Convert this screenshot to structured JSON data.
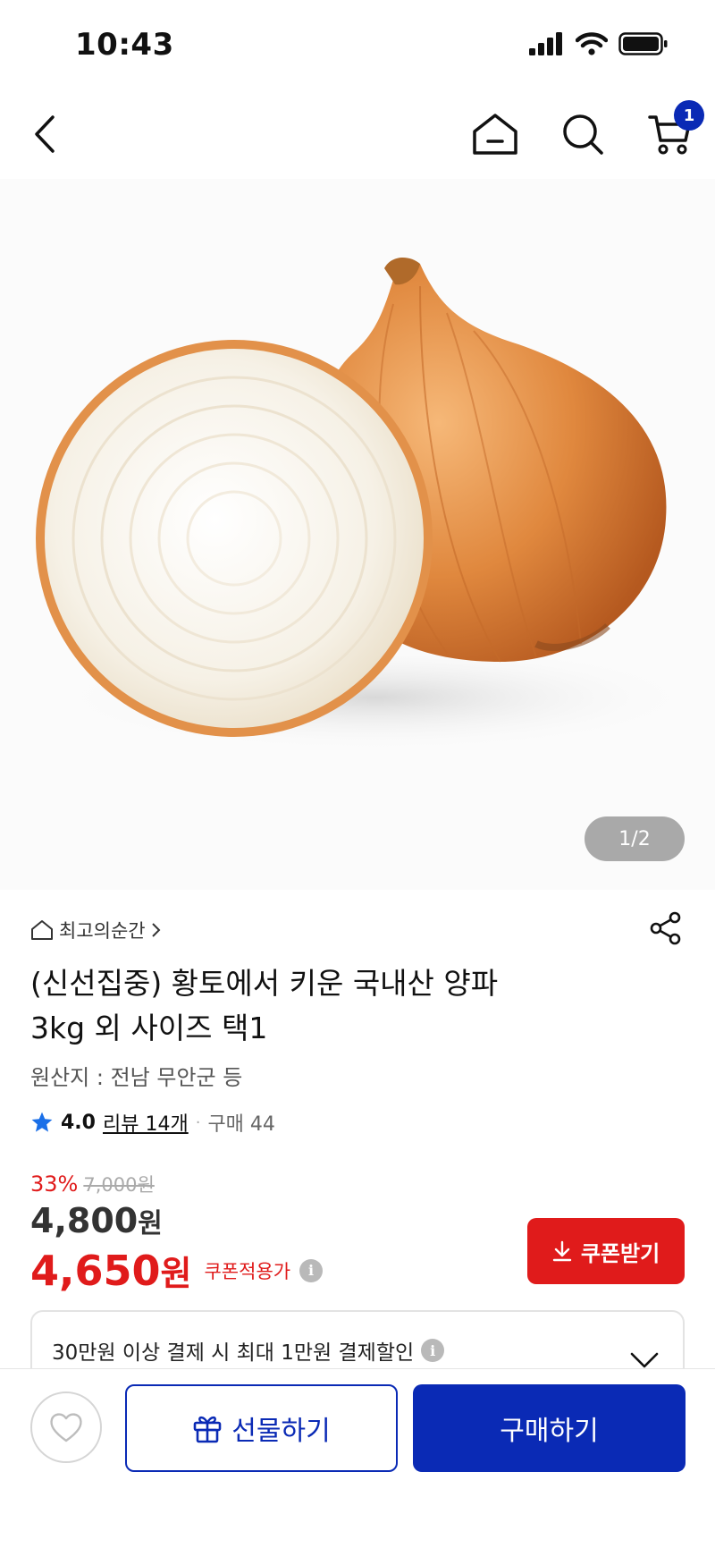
{
  "status_bar": {
    "time": "10:43"
  },
  "nav": {
    "cart_count": "1"
  },
  "hero": {
    "page_indicator": "1/2"
  },
  "product": {
    "brand": "최고의순간",
    "title_line1": "(신선집중) 황토에서 키운 국내산 양파",
    "title_line2": "3kg 외 사이즈 택1",
    "origin": "원산지 : 전남 무안군 등",
    "rating": "4.0",
    "review_link": "리뷰 14개",
    "purchase": "구매 44"
  },
  "price": {
    "discount_rate": "33%",
    "original": "7,000원",
    "sale_amount": "4,800",
    "sale_unit": "원",
    "coupon_amount": "4,650",
    "coupon_unit": "원",
    "coupon_label": "쿠폰적용가",
    "coupon_button": "쿠폰받기"
  },
  "benefit": {
    "text": "30만원 이상 결제 시 최대 1만원 결제할인"
  },
  "bottom": {
    "gift_label": "선물하기",
    "buy_label": "구매하기"
  },
  "colors": {
    "accent_blue": "#0a2ab5",
    "accent_red": "#e01b1b"
  }
}
